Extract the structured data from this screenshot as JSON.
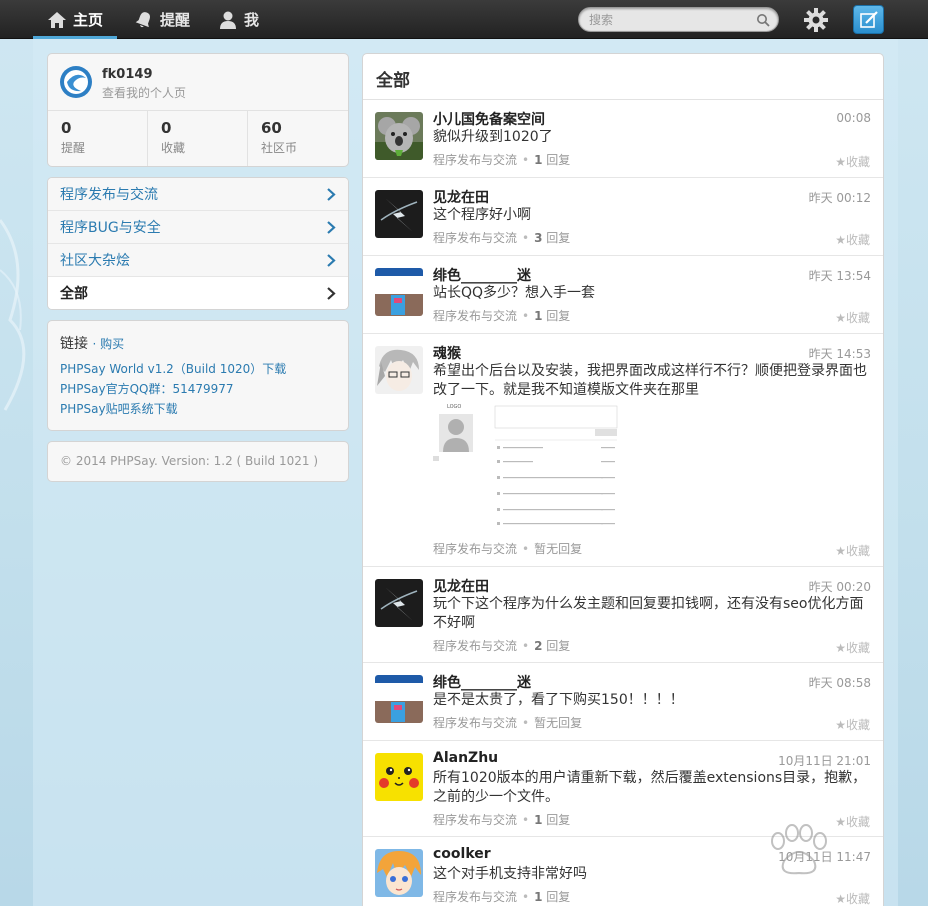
{
  "nav": {
    "home": "主页",
    "remind": "提醒",
    "me": "我",
    "search_placeholder": "搜索"
  },
  "profile": {
    "name": "fk0149",
    "link": "查看我的个人页",
    "stats": [
      {
        "value": "0",
        "label": "提醒"
      },
      {
        "value": "0",
        "label": "收藏"
      },
      {
        "value": "60",
        "label": "社区币"
      }
    ]
  },
  "categories": [
    {
      "label": "程序发布与交流"
    },
    {
      "label": "程序BUG与安全"
    },
    {
      "label": "社区大杂烩"
    },
    {
      "label": "全部"
    }
  ],
  "links": {
    "title": "链接",
    "buy": "· 购买",
    "items": [
      "PHPSay World v1.2（Build 1020）下载",
      "PHPSay官方QQ群：51479977",
      "PHPSay贴吧系统下载"
    ]
  },
  "footer": "© 2014 PHPSay. Version: 1.2 ( Build 1021 )",
  "feed": {
    "title": "全部",
    "fav_label": "收藏",
    "posts": [
      {
        "name": "小儿国免备案空间",
        "time": "00:08",
        "body": "貌似升级到1020了",
        "category": "程序发布与交流",
        "replies": "1",
        "reply_word": "回复"
      },
      {
        "name": "见龙在田",
        "time": "昨天 00:12",
        "body": "这个程序好小啊",
        "category": "程序发布与交流",
        "replies": "3",
        "reply_word": "回复"
      },
      {
        "name": "绯色________迷",
        "time": "昨天 13:54",
        "body": "站长QQ多少？想入手一套",
        "category": "程序发布与交流",
        "replies": "1",
        "reply_word": "回复"
      },
      {
        "name": "魂猴",
        "time": "昨天 14:53",
        "body": "希望出个后台以及安装，我把界面改成这样行不行？顺便把登录界面也改了一下。就是我不知道模版文件夹在那里",
        "category": "程序发布与交流",
        "replies": "",
        "reply_word": "暂无回复"
      },
      {
        "name": "见龙在田",
        "time": "昨天 00:20",
        "body": "玩个下这个程序为什么发主题和回复要扣钱啊，还有没有seo优化方面不好啊",
        "category": "程序发布与交流",
        "replies": "2",
        "reply_word": "回复"
      },
      {
        "name": "绯色________迷",
        "time": "昨天 08:58",
        "body": "是不是太贵了，看了下购买150！！！！",
        "category": "程序发布与交流",
        "replies": "",
        "reply_word": "暂无回复"
      },
      {
        "name": "AlanZhu",
        "time": "10月11日 21:01",
        "body": "所有1020版本的用户请重新下载，然后覆盖extensions目录，抱歉，之前的少一个文件。",
        "category": "程序发布与交流",
        "replies": "1",
        "reply_word": "回复"
      },
      {
        "name": "coolker",
        "time": "10月11日 11:47",
        "body": "这个对手机支持非常好吗",
        "category": "程序发布与交流",
        "replies": "1",
        "reply_word": "回复"
      }
    ]
  },
  "attachment": {
    "logo_text": "LOGO"
  },
  "colors": {
    "accent": "#2b7bb0",
    "topbar": "#2a2a2a",
    "compose": "#2a8fcf"
  }
}
